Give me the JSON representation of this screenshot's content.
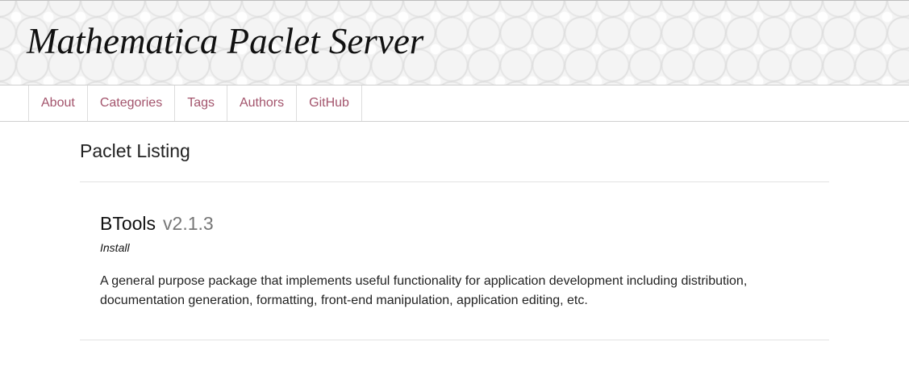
{
  "header": {
    "site_title": "Mathematica Paclet Server"
  },
  "nav": {
    "items": [
      {
        "label": "About"
      },
      {
        "label": "Categories"
      },
      {
        "label": "Tags"
      },
      {
        "label": "Authors"
      },
      {
        "label": "GitHub"
      }
    ]
  },
  "main": {
    "heading": "Paclet Listing",
    "paclets": [
      {
        "name": "BTools",
        "version": "v2.1.3",
        "install_label": "Install",
        "description": "A general purpose package that implements useful functionality for application development including distribution, documentation generation, formatting, front-end manipulation, application editing, etc."
      }
    ]
  },
  "colors": {
    "link": "#a3546c",
    "version_text": "#777777"
  }
}
